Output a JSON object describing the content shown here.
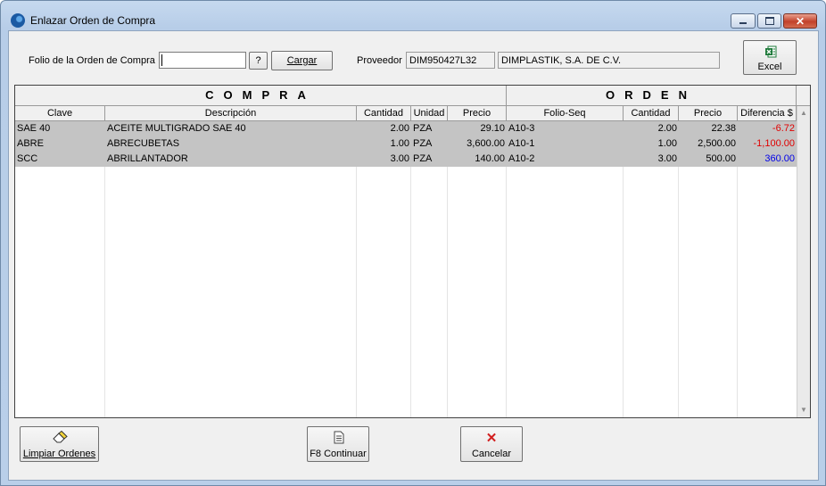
{
  "window": {
    "title": "Enlazar Orden de Compra",
    "close_glyph": "✕"
  },
  "form": {
    "folio_label": "Folio de la Orden de Compra",
    "folio_value": "",
    "help_button": "?",
    "cargar_button": "Cargar",
    "proveedor_label": "Proveedor",
    "proveedor_rfc": "DIM950427L32",
    "proveedor_nombre": "DIMPLASTIK, S.A. DE C.V.",
    "excel_button": "Excel"
  },
  "grid": {
    "group_compra": "COMPRA",
    "group_orden": "ORDEN",
    "columns": [
      "Clave",
      "Descripción",
      "Cantidad",
      "Unidad",
      "Precio",
      "Folio-Seq",
      "Cantidad",
      "Precio",
      "Diferencia $"
    ],
    "rows": [
      {
        "clave": "SAE 40",
        "descripcion": "ACEITE MULTIGRADO SAE 40",
        "cantidad": "2.00",
        "unidad": "PZA",
        "precio": "29.10",
        "folio_seq": "A10-3",
        "cantidad_oc": "2.00",
        "precio_oc": "22.38",
        "diferencia": "-6.72"
      },
      {
        "clave": "ABRE",
        "descripcion": "ABRECUBETAS",
        "cantidad": "1.00",
        "unidad": "PZA",
        "precio": "3,600.00",
        "folio_seq": "A10-1",
        "cantidad_oc": "1.00",
        "precio_oc": "2,500.00",
        "diferencia": "-1,100.00"
      },
      {
        "clave": "SCC",
        "descripcion": "ABRILLANTADOR",
        "cantidad": "3.00",
        "unidad": "PZA",
        "precio": "140.00",
        "folio_seq": "A10-2",
        "cantidad_oc": "3.00",
        "precio_oc": "500.00",
        "diferencia": "360.00"
      }
    ],
    "scroll_up_glyph": "▲",
    "scroll_down_glyph": "▼"
  },
  "footer": {
    "limpiar_button": "Limpiar Ordenes",
    "continuar_button": "F8 Continuar",
    "cancelar_button": "Cancelar",
    "cancelar_glyph": "✕"
  },
  "colors": {
    "negative": "#e00000",
    "positive": "#0000e8",
    "row_background": "#c4c4c4"
  }
}
